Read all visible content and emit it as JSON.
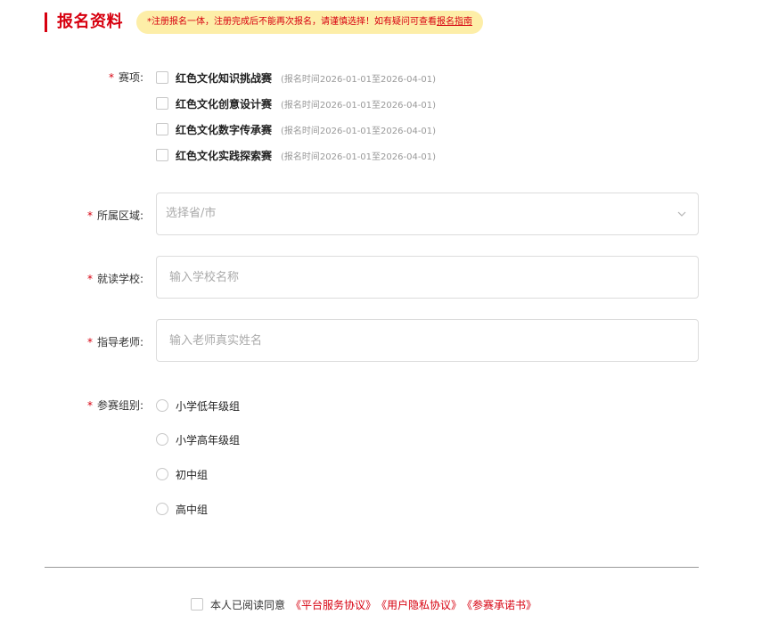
{
  "header": {
    "title": "报名资料",
    "notice_text": "*注册报名一体，注册完成后不能再次报名，请谨慎选择！如有疑问可查看",
    "notice_link": "报名指南"
  },
  "form": {
    "required_mark": "*",
    "competition": {
      "label": "赛项:",
      "options": [
        {
          "name": "红色文化知识挑战赛",
          "time": "(报名时间2026-01-01至2026-04-01)"
        },
        {
          "name": "红色文化创意设计赛",
          "time": "(报名时间2026-01-01至2026-04-01)"
        },
        {
          "name": "红色文化数字传承赛",
          "time": "(报名时间2026-01-01至2026-04-01)"
        },
        {
          "name": "红色文化实践探索赛",
          "time": "(报名时间2026-01-01至2026-04-01)"
        }
      ]
    },
    "region": {
      "label": "所属区域:",
      "placeholder": "选择省/市"
    },
    "school": {
      "label": "就读学校:",
      "placeholder": "输入学校名称"
    },
    "teacher": {
      "label": "指导老师:",
      "placeholder": "输入老师真实姓名"
    },
    "group": {
      "label": "参赛组别:",
      "options": [
        "小学低年级组",
        "小学高年级组",
        "初中组",
        "高中组"
      ]
    }
  },
  "agreement": {
    "text": "本人已阅读同意",
    "links": [
      "《平台服务协议》",
      "《用户隐私协议》",
      "《参赛承诺书》"
    ]
  },
  "icons": {
    "dropdown": "chevron-down-icon"
  },
  "colors": {
    "accent": "#d7000f",
    "notice_bg": "#fdeea8"
  }
}
